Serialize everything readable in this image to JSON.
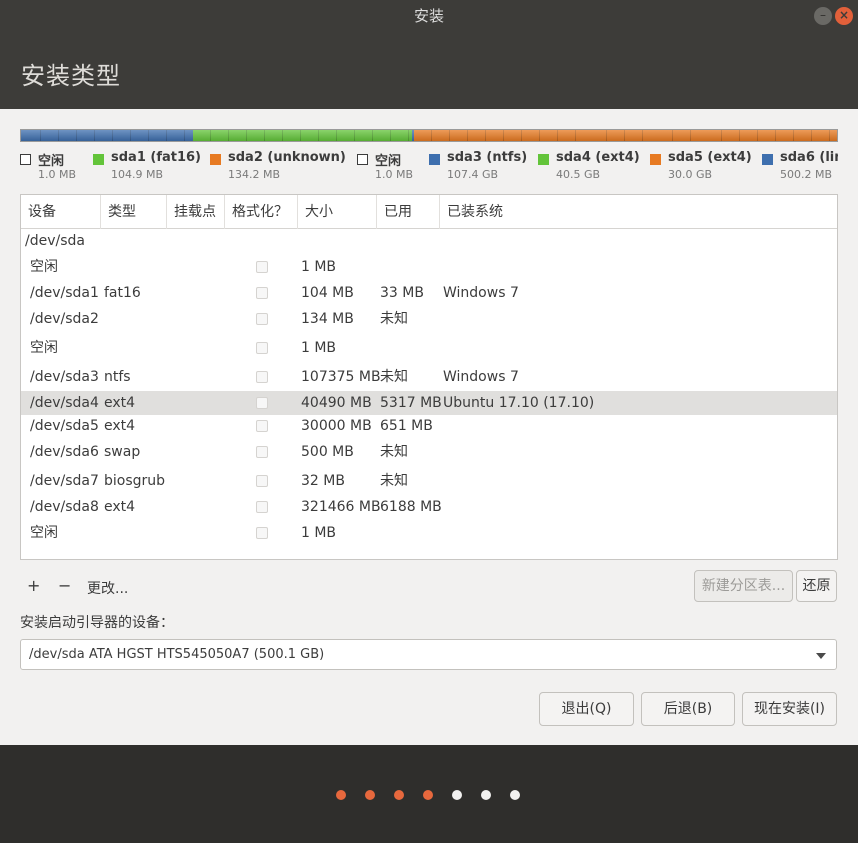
{
  "window": {
    "title": "安装",
    "page_title": "安装类型"
  },
  "partition_bar": [
    {
      "color": "#3e6fae",
      "fraction": 0.0021
    },
    {
      "color": "#3e6fae",
      "fraction": 0.2091
    },
    {
      "color": "#63c43a",
      "fraction": 0.2684
    },
    {
      "color": "#3e6fae",
      "fraction": 0.002
    },
    {
      "color": "#e77a22",
      "fraction": 0.2145
    },
    {
      "color": "#e77a22",
      "fraction": 0.081
    },
    {
      "color": "#e77a22",
      "fraction": 0.06
    },
    {
      "color": "#e77a22",
      "fraction": 0.1629
    }
  ],
  "legend": [
    {
      "name": "空闲",
      "size": "1.0 MB",
      "color": "#ffffff",
      "free": true
    },
    {
      "name": "sda1 (fat16)",
      "size": "104.9 MB",
      "color": "#63c43a",
      "free": false
    },
    {
      "name": "sda2 (unknown)",
      "size": "134.2 MB",
      "color": "#e77a22",
      "free": false
    },
    {
      "name": "空闲",
      "size": "1.0 MB",
      "color": "#ffffff",
      "free": true
    },
    {
      "name": "sda3 (ntfs)",
      "size": "107.4 GB",
      "color": "#3e6fae",
      "free": false
    },
    {
      "name": "sda4 (ext4)",
      "size": "40.5 GB",
      "color": "#63c43a",
      "free": false
    },
    {
      "name": "sda5 (ext4)",
      "size": "30.0 GB",
      "color": "#e77a22",
      "free": false
    },
    {
      "name": "sda6 (lin",
      "size": "500.2 MB",
      "color": "#3e6fae",
      "free": false
    }
  ],
  "table": {
    "headers": [
      "设备",
      "类型",
      "挂载点",
      "格式化？",
      "大小",
      "已用",
      "已装系统"
    ],
    "group": "/dev/sda",
    "rows": [
      {
        "device": "空闲",
        "type": "",
        "size": "1 MB",
        "used": "",
        "system": ""
      },
      {
        "device": "/dev/sda1",
        "type": "fat16",
        "size": "104 MB",
        "used": "33 MB",
        "system": "Windows 7"
      },
      {
        "device": "/dev/sda2",
        "type": "",
        "size": "134 MB",
        "used": "未知",
        "system": ""
      },
      {
        "device": "空闲",
        "type": "",
        "size": "1 MB",
        "used": "",
        "system": ""
      },
      {
        "device": "/dev/sda3",
        "type": "ntfs",
        "size": "107375 MB",
        "used": "未知",
        "system": "Windows 7"
      },
      {
        "device": "/dev/sda4",
        "type": "ext4",
        "size": "40490 MB",
        "used": "5317 MB",
        "system": "Ubuntu 17.10 (17.10)",
        "selected": true
      },
      {
        "device": "/dev/sda5",
        "type": "ext4",
        "size": "30000 MB",
        "used": "651 MB",
        "system": ""
      },
      {
        "device": "/dev/sda6",
        "type": "swap",
        "size": "500 MB",
        "used": "未知",
        "system": ""
      },
      {
        "device": "/dev/sda7",
        "type": "biosgrub",
        "size": "32 MB",
        "used": "未知",
        "system": ""
      },
      {
        "device": "/dev/sda8",
        "type": "ext4",
        "size": "321466 MB",
        "used": "6188 MB",
        "system": ""
      },
      {
        "device": "空闲",
        "type": "",
        "size": "1 MB",
        "used": "",
        "system": ""
      }
    ]
  },
  "toolbar": {
    "add": "+",
    "remove": "−",
    "change": "更改...",
    "new_table": "新建分区表...",
    "revert": "还原"
  },
  "bootloader": {
    "label": "安装启动引导器的设备：",
    "value": "/dev/sda   ATA HGST HTS545050A7 (500.1 GB)"
  },
  "buttons": {
    "quit": "退出(Q)",
    "back": "后退(B)",
    "install": "现在安装(I)"
  },
  "progress_dots": [
    {
      "color": "#e7683d"
    },
    {
      "color": "#e7683d"
    },
    {
      "color": "#e7683d"
    },
    {
      "color": "#e7683d"
    },
    {
      "color": "#f2f1f0"
    },
    {
      "color": "#f2f1f0"
    },
    {
      "color": "#f2f1f0"
    }
  ]
}
